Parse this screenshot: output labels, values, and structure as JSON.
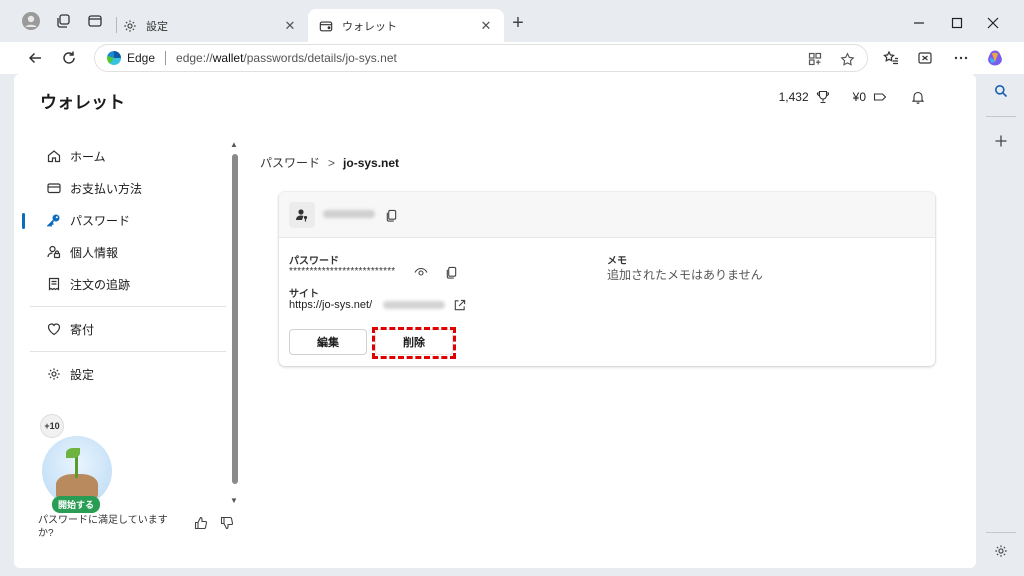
{
  "browser": {
    "tabs": [
      {
        "label": "設定"
      },
      {
        "label": "ウォレット"
      }
    ],
    "address": {
      "edge_label": "Edge",
      "url_prefix": "edge://",
      "url_host": "wallet",
      "url_rest": "/passwords/details/jo-sys.net"
    }
  },
  "wallet": {
    "title": "ウォレット",
    "points": "1,432",
    "balance": "¥0"
  },
  "nav": {
    "items": [
      {
        "label": "ホーム"
      },
      {
        "label": "お支払い方法"
      },
      {
        "label": "パスワード"
      },
      {
        "label": "個人情報"
      },
      {
        "label": "注文の追跡"
      },
      {
        "label": "寄付"
      },
      {
        "label": "設定"
      }
    ]
  },
  "reward": {
    "badge": "+10",
    "start_label": "開始する"
  },
  "feedback": {
    "question": "パスワードに満足していますか?"
  },
  "breadcrumb": {
    "root": "パスワード",
    "separator": ">",
    "current": "jo-sys.net"
  },
  "detail": {
    "password_label": "パスワード",
    "password_mask": "**************************",
    "site_label": "サイト",
    "site_value": "https://jo-sys.net/",
    "memo_label": "メモ",
    "memo_value": "追加されたメモはありません",
    "edit_label": "編集",
    "delete_label": "削除"
  },
  "colors": {
    "accent": "#0f6cbd",
    "highlight": "#e00000",
    "start_pill": "#2a9d55"
  }
}
